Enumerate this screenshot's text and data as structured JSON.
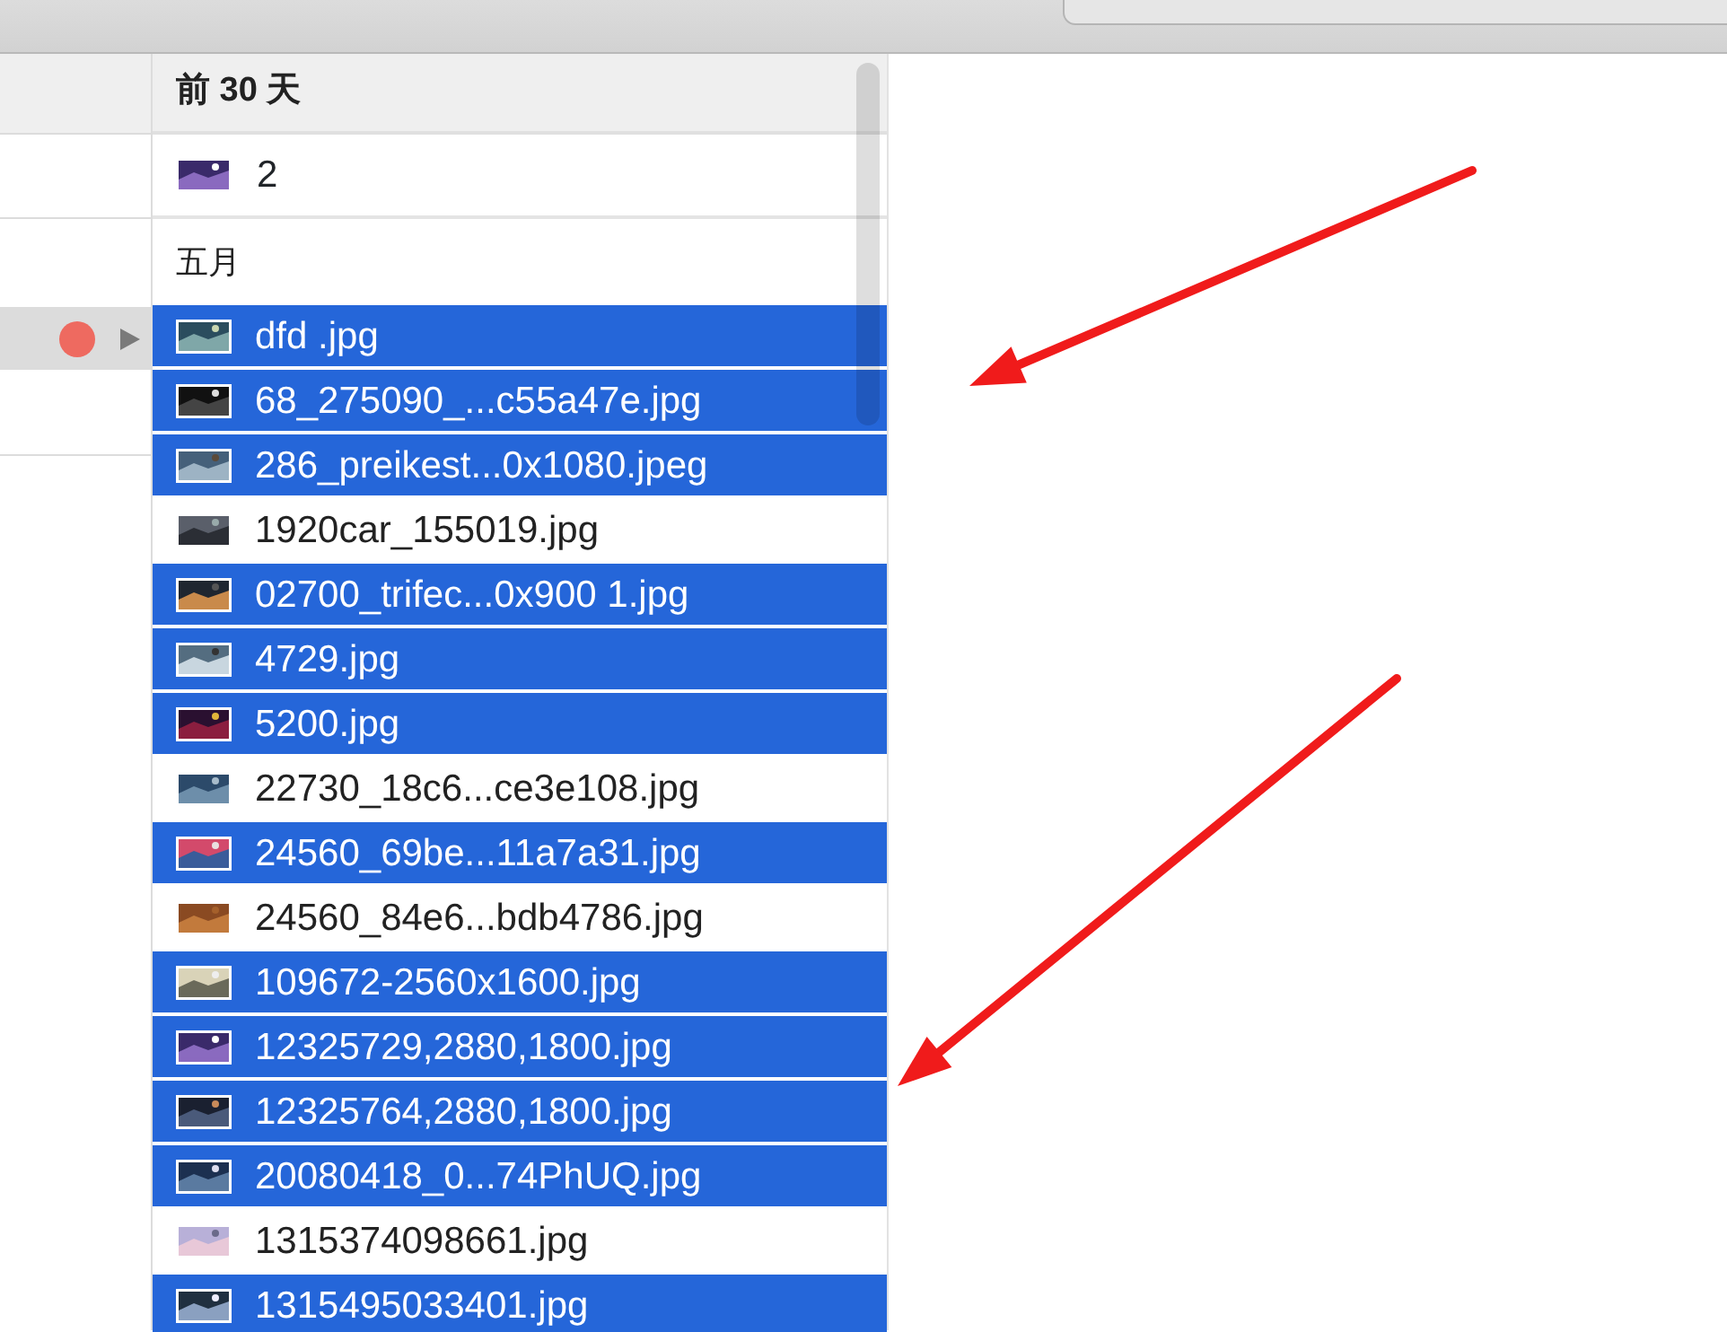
{
  "left_column": {
    "rows": [
      {
        "selected": false
      },
      {
        "selected": false
      },
      {
        "selected": true,
        "color": "#ee6a60",
        "expandable": true
      },
      {
        "selected": false
      }
    ]
  },
  "file_column": {
    "header": "前 30 天",
    "top_item": {
      "name": "2",
      "selected": false
    },
    "group": "五月",
    "files": [
      {
        "name": "dfd .jpg",
        "selected": true
      },
      {
        "name": "68_275090_...c55a47e.jpg",
        "selected": true
      },
      {
        "name": "286_preikest...0x1080.jpeg",
        "selected": true
      },
      {
        "name": "1920car_155019.jpg",
        "selected": false
      },
      {
        "name": "02700_trifec...0x900 1.jpg",
        "selected": true
      },
      {
        "name": "4729.jpg",
        "selected": true
      },
      {
        "name": "5200.jpg",
        "selected": true
      },
      {
        "name": "22730_18c6...ce3e108.jpg",
        "selected": false
      },
      {
        "name": "24560_69be...11a7a31.jpg",
        "selected": true
      },
      {
        "name": "24560_84e6...bdb4786.jpg",
        "selected": false
      },
      {
        "name": "109672-2560x1600.jpg",
        "selected": true
      },
      {
        "name": "12325729,2880,1800.jpg",
        "selected": true
      },
      {
        "name": "12325764,2880,1800.jpg",
        "selected": true
      },
      {
        "name": "20080418_0...74PhUQ.jpg",
        "selected": true
      },
      {
        "name": "1315374098661.jpg",
        "selected": false
      },
      {
        "name": "1315495033401.jpg",
        "selected": true
      }
    ]
  },
  "annotations": [
    {
      "kind": "arrow"
    },
    {
      "kind": "arrow"
    }
  ]
}
